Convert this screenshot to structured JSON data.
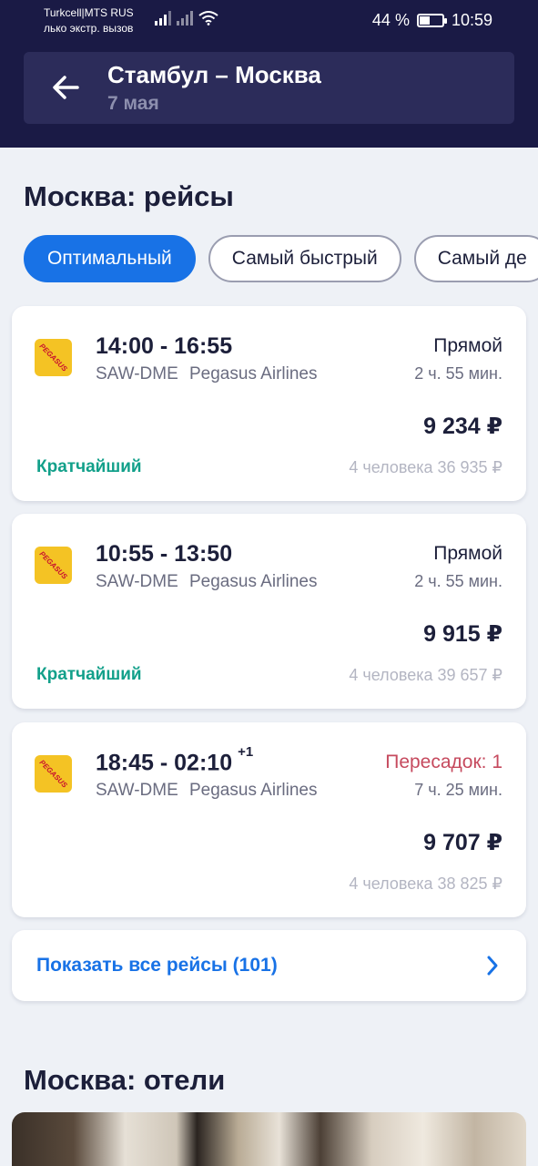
{
  "status_bar": {
    "carrier": "Turkcell|MTS RUS",
    "emergency": "лько экстр. вызов",
    "battery_percent": "44 %",
    "battery_level": 0.44,
    "time": "10:59"
  },
  "header": {
    "route": "Стамбул – Москва",
    "date": "7 мая"
  },
  "flights_section": {
    "title": "Москва: рейсы",
    "sort_tabs": [
      "Оптимальный",
      "Самый быстрый",
      "Самый де"
    ],
    "active_tab": "Оптимальный",
    "flights": [
      {
        "times": "14:00 - 16:55",
        "day_offset": "",
        "route": "SAW-DME",
        "airline": "Pegasus Airlines",
        "logo_text": "PEGASUS",
        "stops": "Прямой",
        "duration": "2 ч. 55 мин.",
        "price": "9 234 ₽",
        "badge": "Кратчайший",
        "total": "4 человека 36 935 ₽"
      },
      {
        "times": "10:55 - 13:50",
        "day_offset": "",
        "route": "SAW-DME",
        "airline": "Pegasus Airlines",
        "logo_text": "PEGASUS",
        "stops": "Прямой",
        "duration": "2 ч. 55 мин.",
        "price": "9 915 ₽",
        "badge": "Кратчайший",
        "total": "4 человека 39 657 ₽"
      },
      {
        "times": "18:45 - 02:10",
        "day_offset": "+1",
        "route": "SAW-DME",
        "airline": "Pegasus Airlines",
        "logo_text": "PEGASUS",
        "stops": "Пересадок: 1",
        "duration": "7 ч. 25 мин.",
        "price": "9 707 ₽",
        "badge": "",
        "total": "4 человека 38 825 ₽"
      }
    ],
    "show_all": "Показать все рейсы (101)"
  },
  "hotels_section": {
    "title": "Москва: отели"
  },
  "colors": {
    "header_bg": "#1a1a45",
    "accent": "#1872e6",
    "badge": "#12a08a",
    "warning": "#c64a5e",
    "logo_bg": "#f4c324"
  }
}
